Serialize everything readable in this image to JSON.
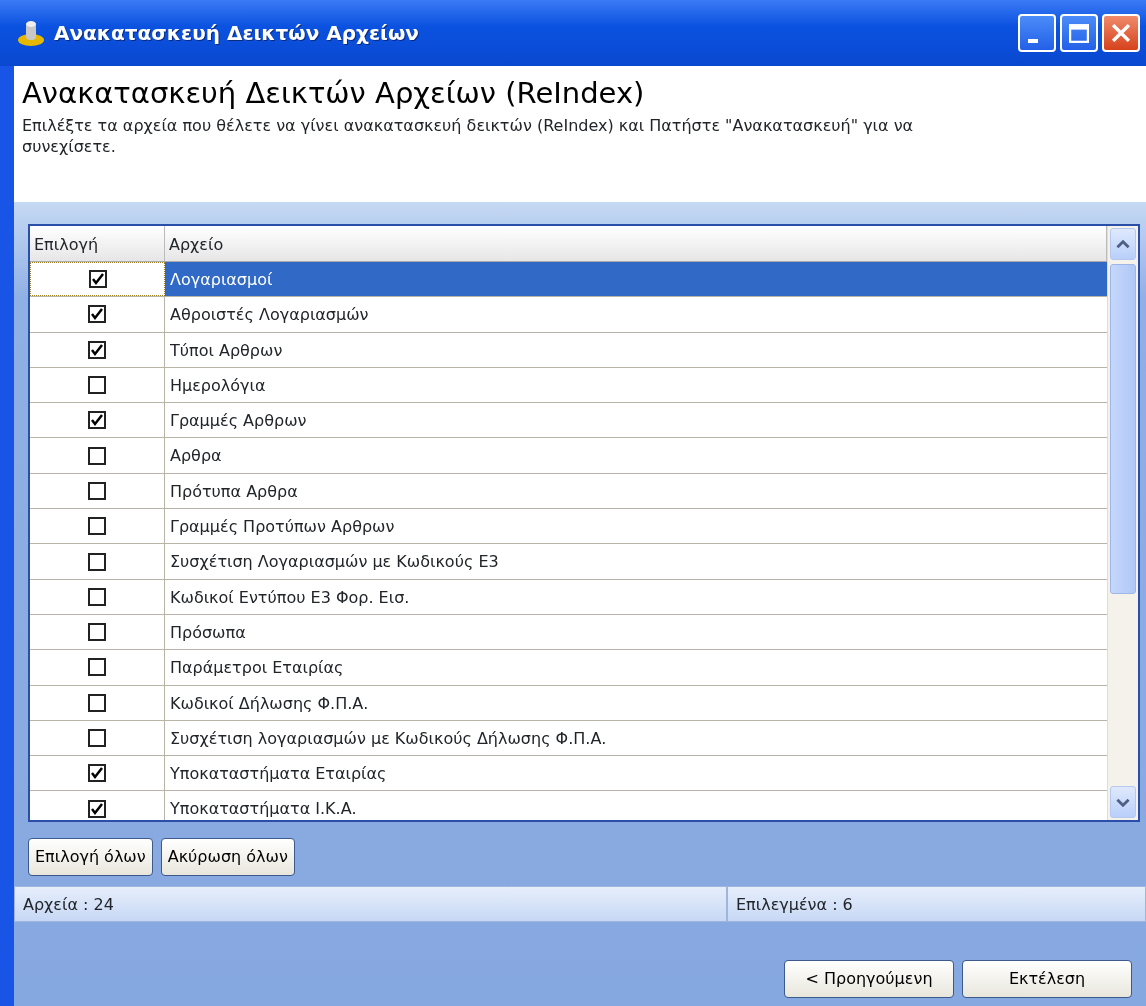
{
  "window": {
    "title": "Ανακατασκευή Δεικτών Αρχείων"
  },
  "header": {
    "heading": "Ανακατασκευή Δεικτών Αρχείων (ReIndex)",
    "description": "Επιλέξτε τα αρχεία που θέλετε να γίνει ανακατασκευή δεικτών (ReIndex) και Πατήστε \"Ανακατασκευή\" για να συνεχίσετε."
  },
  "table": {
    "columns": [
      "Επιλογή",
      "Αρχείο"
    ],
    "rows": [
      {
        "name": "Λογαριασμοί",
        "checked": true,
        "selected": true
      },
      {
        "name": "Αθροιστές Λογαριασμών",
        "checked": true,
        "selected": false
      },
      {
        "name": "Τύποι Αρθρων",
        "checked": true,
        "selected": false
      },
      {
        "name": "Ημερολόγια",
        "checked": false,
        "selected": false
      },
      {
        "name": "Γραμμές Αρθρων",
        "checked": true,
        "selected": false
      },
      {
        "name": "Αρθρα",
        "checked": false,
        "selected": false
      },
      {
        "name": "Πρότυπα Αρθρα",
        "checked": false,
        "selected": false
      },
      {
        "name": "Γραμμές Προτύπων Αρθρων",
        "checked": false,
        "selected": false
      },
      {
        "name": "Συσχέτιση Λογαριασμών με Κωδικούς Ε3",
        "checked": false,
        "selected": false
      },
      {
        "name": "Κωδικοί Εντύπου Ε3 Φορ. Εισ.",
        "checked": false,
        "selected": false
      },
      {
        "name": "Πρόσωπα",
        "checked": false,
        "selected": false
      },
      {
        "name": "Παράμετροι Εταιρίας",
        "checked": false,
        "selected": false
      },
      {
        "name": "Κωδικοί Δήλωσης Φ.Π.Α.",
        "checked": false,
        "selected": false
      },
      {
        "name": "Συσχέτιση λογαριασμών με Κωδικούς Δήλωσης Φ.Π.Α.",
        "checked": false,
        "selected": false
      },
      {
        "name": "Υποκαταστήματα Εταιρίας",
        "checked": true,
        "selected": false
      },
      {
        "name": "Υποκαταστήματα Ι.Κ.Α.",
        "checked": true,
        "selected": false
      }
    ]
  },
  "selection_buttons": [
    "Επιλογή όλων",
    "Ακύρωση όλων"
  ],
  "status_bar": [
    "Αρχεία : 24",
    "Επιλεγμένα : 6"
  ],
  "footer_buttons": [
    "< Προηγούμενη",
    "Εκτέλεση"
  ]
}
